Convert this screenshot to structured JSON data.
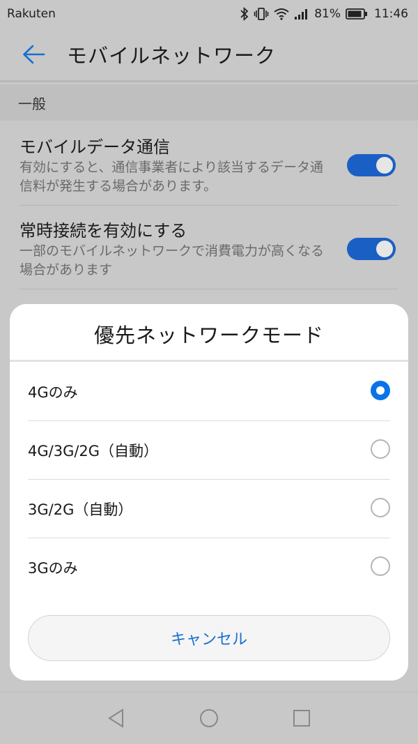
{
  "status_bar": {
    "carrier": "Rakuten",
    "battery_percent": "81%",
    "time": "11:46",
    "icons": [
      "bluetooth-icon",
      "vibrate-icon",
      "wifi-icon",
      "signal-icon",
      "battery-icon"
    ]
  },
  "header": {
    "title": "モバイルネットワーク"
  },
  "settings": {
    "section_label": "一般",
    "items": [
      {
        "title": "モバイルデータ通信",
        "description": "有効にすると、通信事業者により該当するデータ通信料が発生する場合があります。",
        "toggle_on": true
      },
      {
        "title": "常時接続を有効にする",
        "description": "一部のモバイルネットワークで消費電力が高くなる場合があります",
        "toggle_on": true
      }
    ]
  },
  "dialog": {
    "title": "優先ネットワークモード",
    "options": [
      {
        "label": "4Gのみ",
        "selected": true
      },
      {
        "label": "4G/3G/2G（自動）",
        "selected": false
      },
      {
        "label": "3G/2G（自動）",
        "selected": false
      },
      {
        "label": "3Gのみ",
        "selected": false
      }
    ],
    "cancel_label": "キャンセル"
  },
  "colors": {
    "accent": "#1a5fc4",
    "radio_selected": "#0a73e8",
    "cancel_text": "#1a6fd0",
    "dim_background": "#c8c8c8"
  }
}
